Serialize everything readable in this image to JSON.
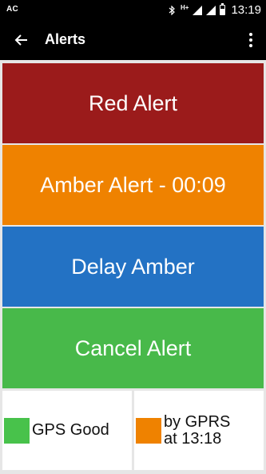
{
  "status_bar": {
    "carrier": "AC",
    "network": "H+",
    "time": "13:19",
    "icons": [
      "bluetooth-icon",
      "signal-icon",
      "battery-icon"
    ]
  },
  "app_bar": {
    "title": "Alerts",
    "back_icon": "arrow-left-icon",
    "menu_icon": "overflow-menu-icon"
  },
  "buttons": [
    {
      "label": "Red Alert",
      "color": "#9b1b1b"
    },
    {
      "label": "Amber Alert - 00:09",
      "color": "#ef8200"
    },
    {
      "label": "Delay Amber",
      "color": "#2372c4"
    },
    {
      "label": "Cancel Alert",
      "color": "#48b94a"
    }
  ],
  "tiles": {
    "gps": {
      "text": "GPS Good",
      "color": "#48c24b"
    },
    "link": {
      "line1": "by GPRS",
      "line2": "at 13:18",
      "color": "#ef8200"
    }
  }
}
